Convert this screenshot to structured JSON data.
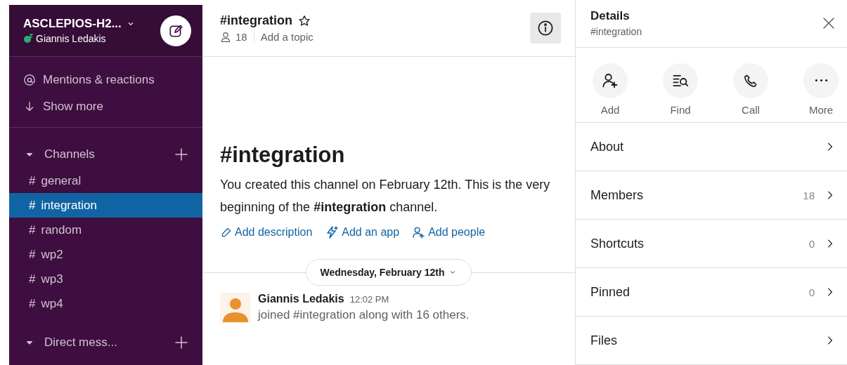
{
  "workspace": {
    "name": "ASCLEPIOS-H2...",
    "user": "Giannis Ledakis"
  },
  "nav": [
    {
      "kind": "mentions",
      "label": "Mentions & reactions"
    },
    {
      "kind": "more",
      "label": "Show more"
    }
  ],
  "channels_section": {
    "label": "Channels",
    "expanded": true
  },
  "channels": [
    {
      "symbol": "#",
      "name": "general",
      "selected": false
    },
    {
      "symbol": "#",
      "name": "integration",
      "selected": true
    },
    {
      "symbol": "#",
      "name": "random",
      "selected": false
    },
    {
      "symbol": "#",
      "name": "wp2",
      "selected": false
    },
    {
      "symbol": "#",
      "name": "wp3",
      "selected": false
    },
    {
      "symbol": "#",
      "name": "wp4",
      "selected": false
    }
  ],
  "dm_section": {
    "label": "Direct mess...",
    "expanded": true
  },
  "header": {
    "title": "#integration",
    "starred": false,
    "member_count": "18",
    "topic": "Add a topic"
  },
  "intro": {
    "title": "#integration",
    "text": "You created this channel on February 12th. This is the very beginning of the **#integration** channel.",
    "actions": [
      {
        "kind": "description",
        "label": "Add description"
      },
      {
        "kind": "app",
        "label": "Add an app"
      },
      {
        "kind": "people",
        "label": "Add people"
      }
    ]
  },
  "date_divider": "Wednesday, February 12th",
  "messages": [
    {
      "author": "Giannis Ledakis",
      "time": "12:02 PM",
      "text": "joined #integration along with 16 others."
    }
  ],
  "details": {
    "title": "Details",
    "channel": "#integration",
    "actions": [
      {
        "kind": "add",
        "label": "Add"
      },
      {
        "kind": "find",
        "label": "Find"
      },
      {
        "kind": "call",
        "label": "Call"
      },
      {
        "kind": "more",
        "label": "More"
      }
    ],
    "rows": [
      {
        "label": "About"
      },
      {
        "label": "Members",
        "count": "18"
      },
      {
        "label": "Shortcuts",
        "count": "0"
      },
      {
        "label": "Pinned",
        "count": "0"
      },
      {
        "label": "Files"
      }
    ]
  }
}
